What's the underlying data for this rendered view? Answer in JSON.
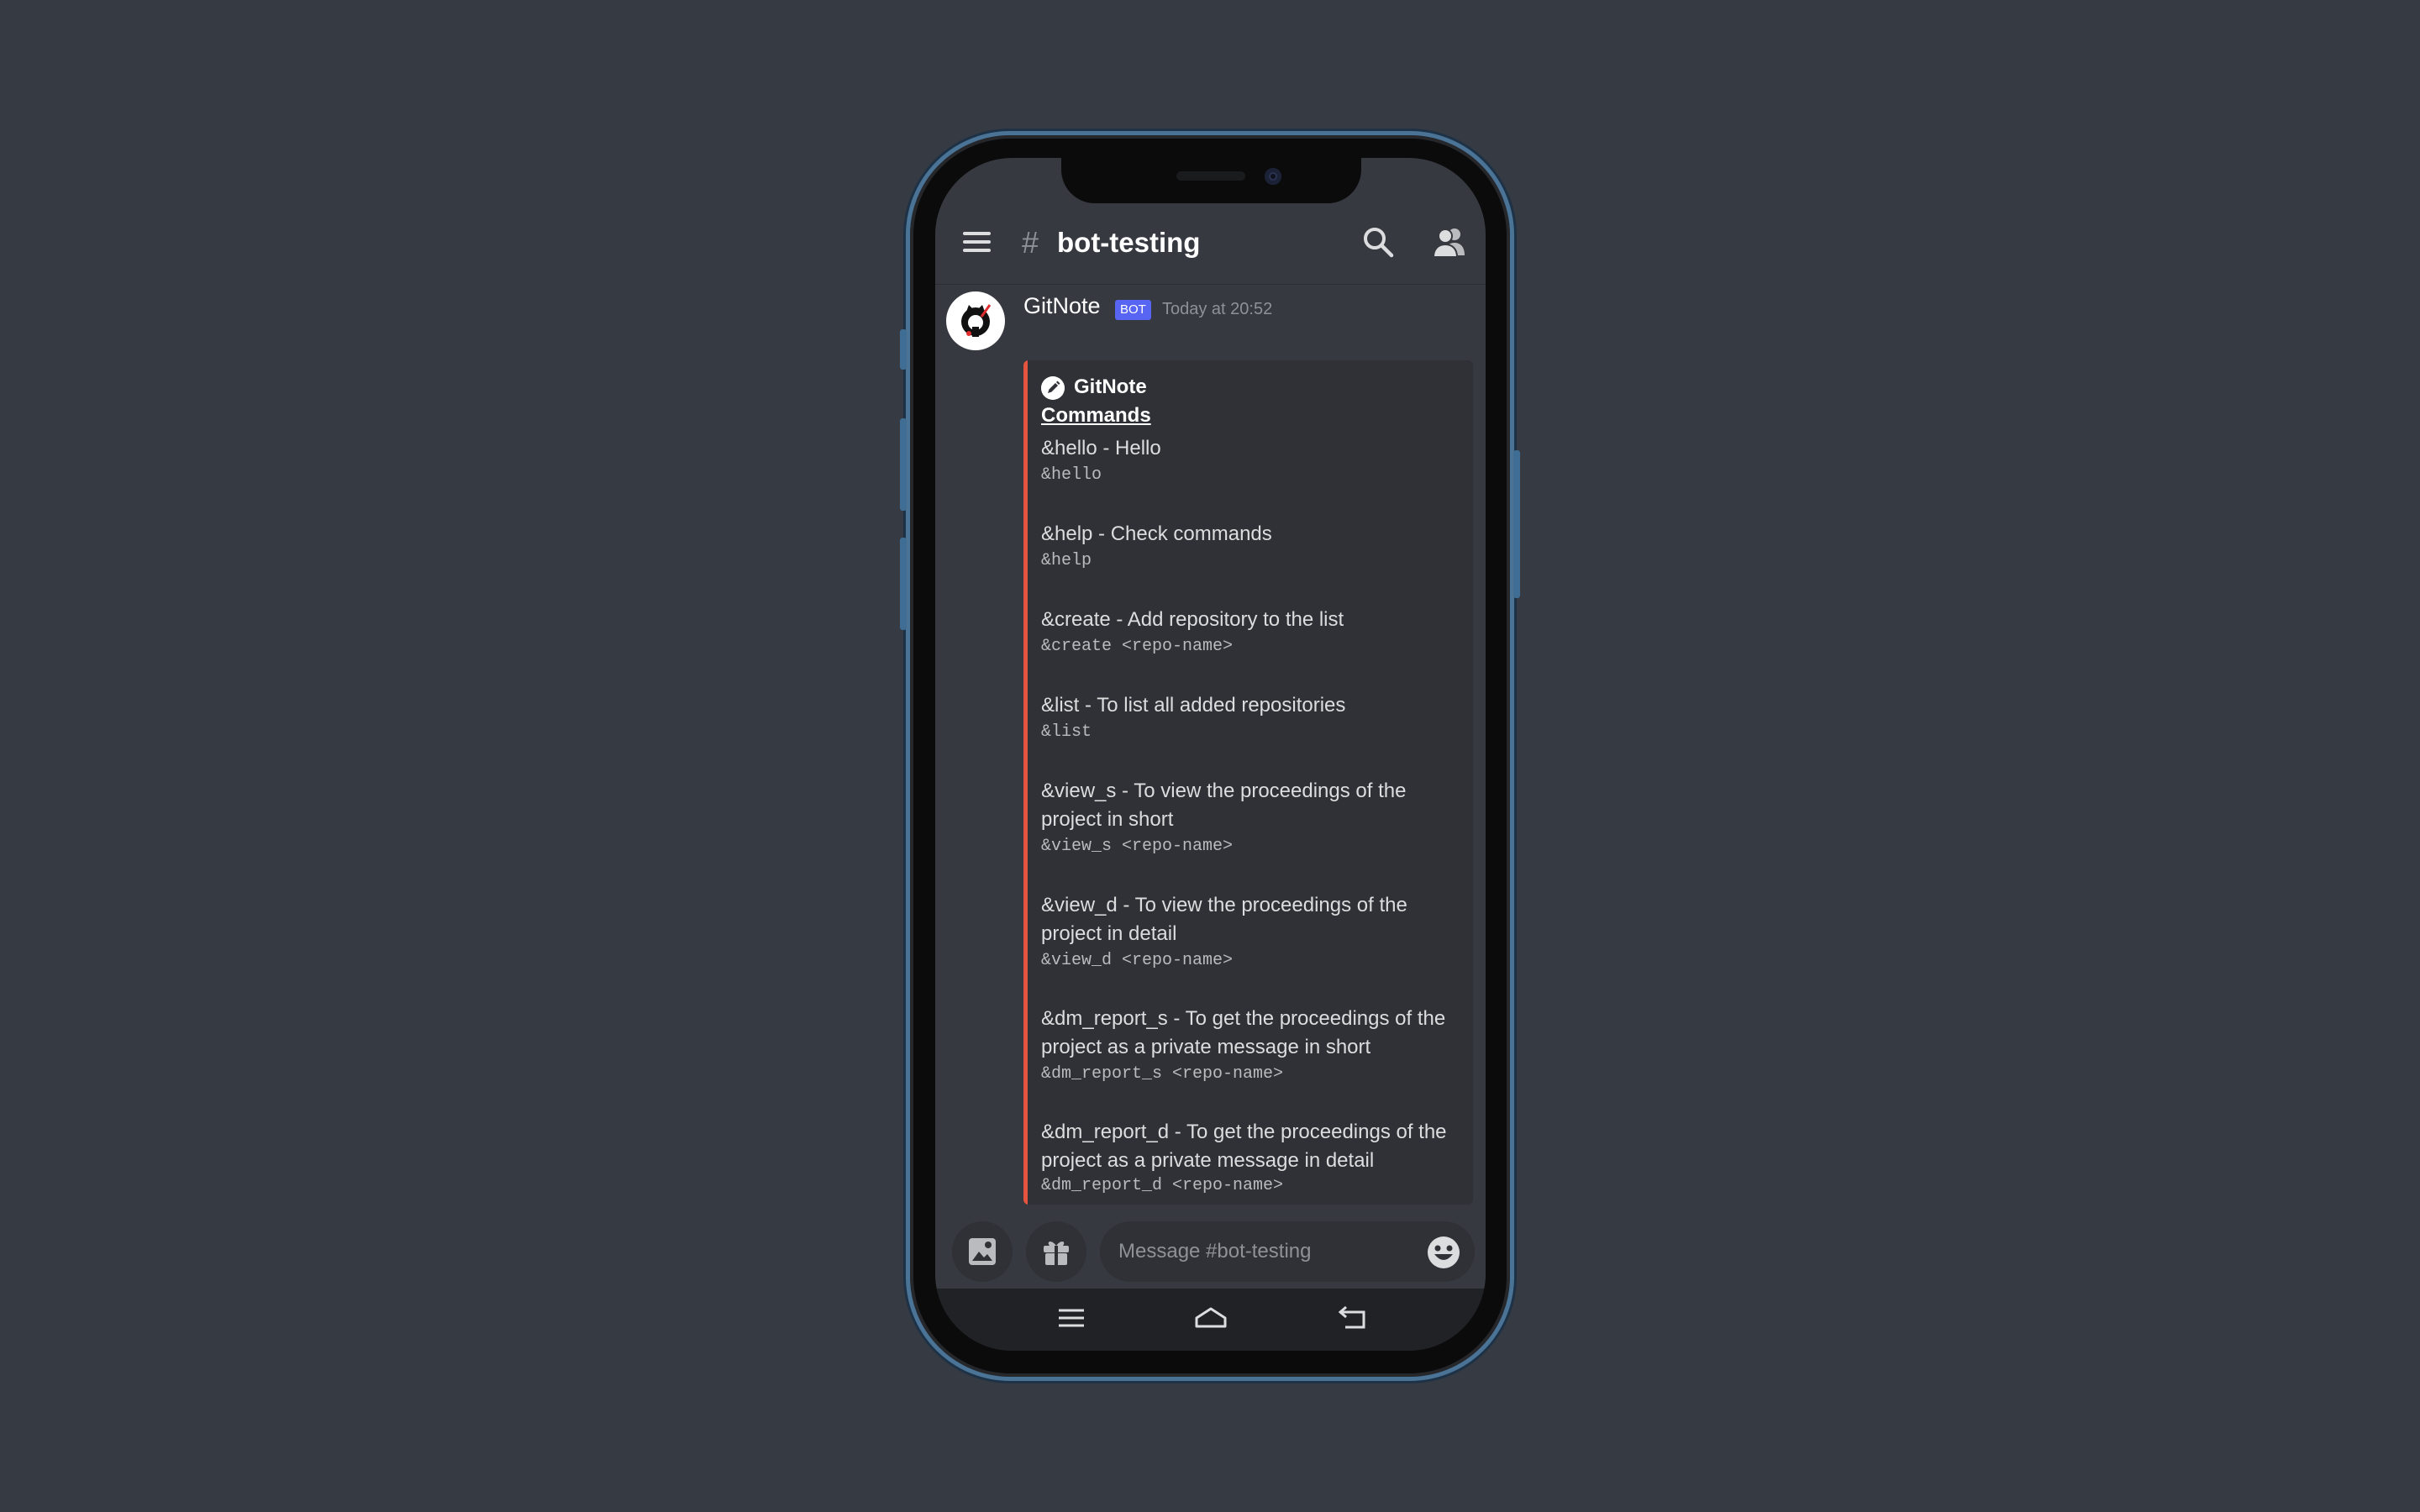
{
  "header": {
    "hash": "#",
    "channel": "bot-testing"
  },
  "message": {
    "author": "GitNote",
    "badge": "BOT",
    "timestamp": "Today at 20:52"
  },
  "embed": {
    "accent_color": "#e5543f",
    "author": "GitNote",
    "title": "Commands",
    "fields": [
      {
        "name": "&hello - Hello",
        "value": "&hello"
      },
      {
        "name": "&help - Check commands",
        "value": "&help"
      },
      {
        "name": "&create - Add repository to the list",
        "value": "&create <repo-name>"
      },
      {
        "name": "&list - To list all added repositories",
        "value": "&list"
      },
      {
        "name": "&view_s - To view the proceedings of the project in short",
        "value": "&view_s <repo-name>"
      },
      {
        "name": "&view_d - To view the proceedings of the project in detail",
        "value": "&view_d <repo-name>"
      },
      {
        "name": "&dm_report_s - To get the proceedings of the project as a private message in short",
        "value": "&dm_report_s <repo-name>"
      },
      {
        "name": "&dm_report_d - To get the proceedings of the project as a private message in detail",
        "value": "&dm_report_d <repo-name>"
      }
    ]
  },
  "composer": {
    "placeholder": "Message #bot-testing"
  },
  "icons": {
    "menu": "hamburger-menu-icon",
    "search": "search-icon",
    "members": "members-icon",
    "image": "image-icon",
    "gift": "gift-icon",
    "emoji": "emoji-icon",
    "nav_recents": "recents-icon",
    "nav_home": "home-icon",
    "nav_back": "back-icon"
  },
  "colors": {
    "background": "#363a43",
    "chat_bg": "#36393f",
    "embed_bg": "#2f3136",
    "badge": "#5865f2"
  }
}
